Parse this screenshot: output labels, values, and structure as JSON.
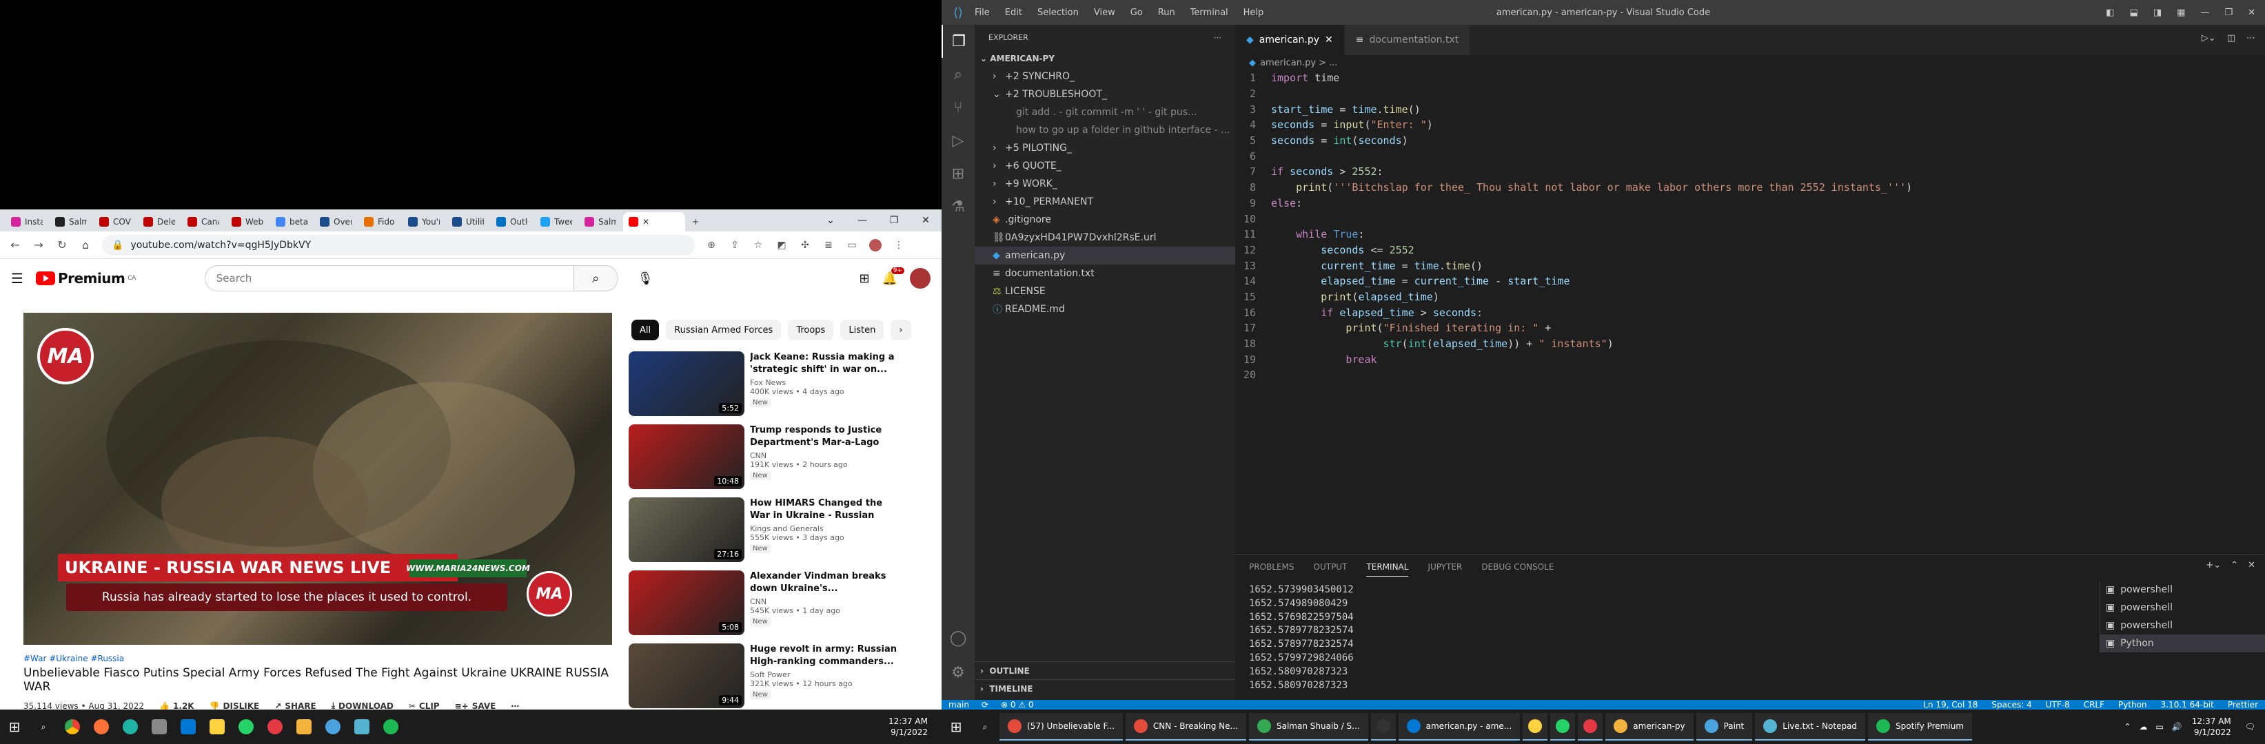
{
  "chrome": {
    "tabs": [
      {
        "label": "Insta",
        "color": "#d6249f"
      },
      {
        "label": "Salmo",
        "color": "#222222"
      },
      {
        "label": "COVIC",
        "color": "#c00000"
      },
      {
        "label": "Delet",
        "color": "#c00000"
      },
      {
        "label": "Cana",
        "color": "#c00000"
      },
      {
        "label": "Webs",
        "color": "#c00000"
      },
      {
        "label": "beta",
        "color": "#4285f4"
      },
      {
        "label": "Overv",
        "color": "#1b4b8a"
      },
      {
        "label": "Fido",
        "color": "#e76f00"
      },
      {
        "label": "You'r",
        "color": "#1b4b8a"
      },
      {
        "label": "Utilit",
        "color": "#1b4b8a"
      },
      {
        "label": "Outlo",
        "color": "#0072c6"
      },
      {
        "label": "Twee",
        "color": "#1da1f2"
      },
      {
        "label": "Salm",
        "color": "#d6249f"
      }
    ],
    "url": "youtube.com/watch?v=qgH5JyDbkVY",
    "notif_count": "9+"
  },
  "youtube": {
    "logo": "Premium",
    "logo_region": "CA",
    "search_placeholder": "Search",
    "video": {
      "banner_title": "UKRAINE - RUSSIA WAR NEWS LIVE",
      "banner_site": "WWW.MARIA24NEWS.COM",
      "banner_sub": "Russia has already started to lose the places it used to control.",
      "logo_text": "MA"
    },
    "hashtags": "#War #Ukraine #Russia",
    "title": "Unbelievable Fiasco Putins Special Army Forces Refused The Fight Against Ukraine UKRAINE RUSSIA WAR",
    "views": "35,114 views • Aug 31, 2022",
    "likes": "1.2K",
    "dislike": "DISLIKE",
    "share": "SHARE",
    "download": "DOWNLOAD",
    "clip": "CLIP",
    "save": "SAVE",
    "chips": [
      "All",
      "Russian Armed Forces",
      "Troops",
      "Listen"
    ],
    "recommendations": [
      {
        "title": "Jack Keane: Russia making a 'strategic shift' in war on...",
        "channel": "Fox News",
        "meta": "400K views • 4 days ago",
        "badge": "New",
        "duration": "5:52",
        "thumb": "#1e3a78"
      },
      {
        "title": "Trump responds to Justice Department's Mar-a-Lago filing",
        "channel": "CNN",
        "meta": "191K views • 2 hours ago",
        "badge": "New",
        "duration": "10:48",
        "thumb": "#b91d1d"
      },
      {
        "title": "How HIMARS Changed the War in Ukraine - Russian Invasion...",
        "channel": "Kings and Generals",
        "meta": "555K views • 3 days ago",
        "badge": "New",
        "duration": "27:16",
        "thumb": "#6d6b57"
      },
      {
        "title": "Alexander Vindman breaks down Ukraine's...",
        "channel": "CNN",
        "meta": "545K views • 1 day ago",
        "badge": "New",
        "duration": "5:08",
        "thumb": "#b91d1d"
      },
      {
        "title": "Huge revolt in army: Russian High-ranking commanders...",
        "channel": "Soft Power",
        "meta": "321K views • 12 hours ago",
        "badge": "New",
        "duration": "9:44",
        "thumb": "#5a4a3a"
      }
    ]
  },
  "vscode": {
    "menu": [
      "File",
      "Edit",
      "Selection",
      "View",
      "Go",
      "Run",
      "Terminal",
      "Help"
    ],
    "window_title": "american.py - american-py - Visual Studio Code",
    "explorer_label": "EXPLORER",
    "project": "AMERICAN-PY",
    "tree": [
      {
        "label": "+2 SYNCHRO_",
        "indent": 1,
        "kind": "folder"
      },
      {
        "label": "+2 TROUBLESHOOT_",
        "indent": 1,
        "kind": "folder-open"
      },
      {
        "label": "git add . - git commit -m ' ' - git pus...",
        "indent": 2,
        "kind": "note"
      },
      {
        "label": "how to go up a folder in github interface - ...",
        "indent": 2,
        "kind": "note"
      },
      {
        "label": "+5 PILOTING_",
        "indent": 1,
        "kind": "folder"
      },
      {
        "label": "+6 QUOTE_",
        "indent": 1,
        "kind": "folder"
      },
      {
        "label": "+9 WORK_",
        "indent": 1,
        "kind": "folder"
      },
      {
        "label": "+10_ PERMANENT",
        "indent": 1,
        "kind": "folder"
      },
      {
        "label": ".gitignore",
        "indent": 1,
        "kind": "git"
      },
      {
        "label": "0A9zyxHD41PW7Dvxhl2RsE.url",
        "indent": 1,
        "kind": "url"
      },
      {
        "label": "american.py",
        "indent": 1,
        "kind": "py",
        "selected": true
      },
      {
        "label": "documentation.txt",
        "indent": 1,
        "kind": "txt"
      },
      {
        "label": "LICENSE",
        "indent": 1,
        "kind": "license"
      },
      {
        "label": "README.md",
        "indent": 1,
        "kind": "md"
      }
    ],
    "outline": "OUTLINE",
    "timeline": "TIMELINE",
    "tabs": [
      {
        "label": "american.py",
        "active": true
      },
      {
        "label": "documentation.txt",
        "active": false
      }
    ],
    "breadcrumb": "american.py > ...",
    "code": [
      [
        [
          "import",
          "kw"
        ],
        [
          " time",
          "tx"
        ]
      ],
      [],
      [
        [
          "start_time",
          "var"
        ],
        [
          " = ",
          "tx"
        ],
        [
          "time",
          "var"
        ],
        [
          ".",
          "tx"
        ],
        [
          "time",
          "fn"
        ],
        [
          "()",
          "tx"
        ]
      ],
      [
        [
          "seconds",
          "var"
        ],
        [
          " = ",
          "tx"
        ],
        [
          "input",
          "fn"
        ],
        [
          "(",
          "tx"
        ],
        [
          "\"Enter: \"",
          "str"
        ],
        [
          ")",
          "tx"
        ]
      ],
      [
        [
          "seconds",
          "var"
        ],
        [
          " = ",
          "tx"
        ],
        [
          "int",
          "cls"
        ],
        [
          "(",
          "tx"
        ],
        [
          "seconds",
          "var"
        ],
        [
          ")",
          "tx"
        ]
      ],
      [],
      [
        [
          "if",
          "kw"
        ],
        [
          " seconds ",
          "var"
        ],
        [
          "> ",
          "tx"
        ],
        [
          "2552",
          "num"
        ],
        [
          ":",
          "tx"
        ]
      ],
      [
        [
          "    print",
          "fn"
        ],
        [
          "(",
          "tx"
        ],
        [
          "'''Bitchslap for thee_ Thou shalt not labor or make labor others more than 2552 instants_'''",
          "str"
        ],
        [
          ")",
          "tx"
        ]
      ],
      [
        [
          "else",
          "kw"
        ],
        [
          ":",
          "tx"
        ]
      ],
      [],
      [
        [
          "    while",
          "kw"
        ],
        [
          " ",
          "tx"
        ],
        [
          "True",
          "kw2"
        ],
        [
          ":",
          "tx"
        ]
      ],
      [
        [
          "        seconds",
          "var"
        ],
        [
          " <= ",
          "tx"
        ],
        [
          "2552",
          "num"
        ]
      ],
      [
        [
          "        current_time",
          "var"
        ],
        [
          " = ",
          "tx"
        ],
        [
          "time",
          "var"
        ],
        [
          ".",
          "tx"
        ],
        [
          "time",
          "fn"
        ],
        [
          "()",
          "tx"
        ]
      ],
      [
        [
          "        elapsed_time",
          "var"
        ],
        [
          " = ",
          "tx"
        ],
        [
          "current_time",
          "var"
        ],
        [
          " - ",
          "tx"
        ],
        [
          "start_time",
          "var"
        ]
      ],
      [
        [
          "        print",
          "fn"
        ],
        [
          "(",
          "tx"
        ],
        [
          "elapsed_time",
          "var"
        ],
        [
          ")",
          "tx"
        ]
      ],
      [
        [
          "        if",
          "kw"
        ],
        [
          " elapsed_time ",
          "var"
        ],
        [
          "> ",
          "tx"
        ],
        [
          "seconds",
          "var"
        ],
        [
          ":",
          "tx"
        ]
      ],
      [
        [
          "            print",
          "fn"
        ],
        [
          "(",
          "tx"
        ],
        [
          "\"Finished iterating in: \"",
          "str"
        ],
        [
          " +",
          "tx"
        ]
      ],
      [
        [
          "                  str",
          "cls"
        ],
        [
          "(",
          "tx"
        ],
        [
          "int",
          "cls"
        ],
        [
          "(",
          "tx"
        ],
        [
          "elapsed_time",
          "var"
        ],
        [
          "))",
          "tx"
        ],
        [
          " + ",
          "tx"
        ],
        [
          "\" instants\"",
          "str"
        ],
        [
          ")",
          "tx"
        ]
      ],
      [
        [
          "            break",
          "kw"
        ]
      ],
      []
    ],
    "panel_tabs": [
      "PROBLEMS",
      "OUTPUT",
      "TERMINAL",
      "JUPYTER",
      "DEBUG CONSOLE"
    ],
    "terminal_lines": [
      "1652.5739903450012",
      "1652.574989080429",
      "1652.5769822597504",
      "1652.5789778232574",
      "1652.5789778232574",
      "1652.5799729824066",
      "1652.580970287323",
      "1652.580970287323"
    ],
    "shells": [
      "powershell",
      "powershell",
      "powershell",
      "Python"
    ],
    "status_left": [
      "main",
      "⟳",
      "⊗ 0 ⚠ 0"
    ],
    "status_right": [
      "Ln 19, Col 18",
      "Spaces: 4",
      "UTF-8",
      "CRLF",
      "Python",
      "3.10.1 64-bit",
      "Prettier"
    ]
  },
  "taskbar_left": {
    "time": "12:37 AM",
    "date": "9/1/2022"
  },
  "taskbar_right": {
    "apps": [
      {
        "label": "(57) Unbelievable F...",
        "color": "#e34b3a"
      },
      {
        "label": "CNN - Breaking Ne...",
        "color": "#e34b3a"
      },
      {
        "label": "Salman Shuaib / S...",
        "color": "#34a853"
      },
      {
        "label": "",
        "color": "#333"
      },
      {
        "label": "american.py - ame...",
        "color": "#0078d4"
      },
      {
        "label": "",
        "color": "#ffd23f"
      },
      {
        "label": "",
        "color": "#25d366"
      },
      {
        "label": "",
        "color": "#e63946"
      },
      {
        "label": "american-py",
        "color": "#f3b33d"
      },
      {
        "label": "Paint",
        "color": "#4aa3df"
      },
      {
        "label": "Live.txt - Notepad",
        "color": "#56b4d3"
      },
      {
        "label": "Spotify Premium",
        "color": "#1db954"
      }
    ],
    "time": "12:37 AM",
    "date": "9/1/2022"
  },
  "colors": {
    "vscode_accent": "#007acc",
    "youtube_red": "#ff0000"
  }
}
